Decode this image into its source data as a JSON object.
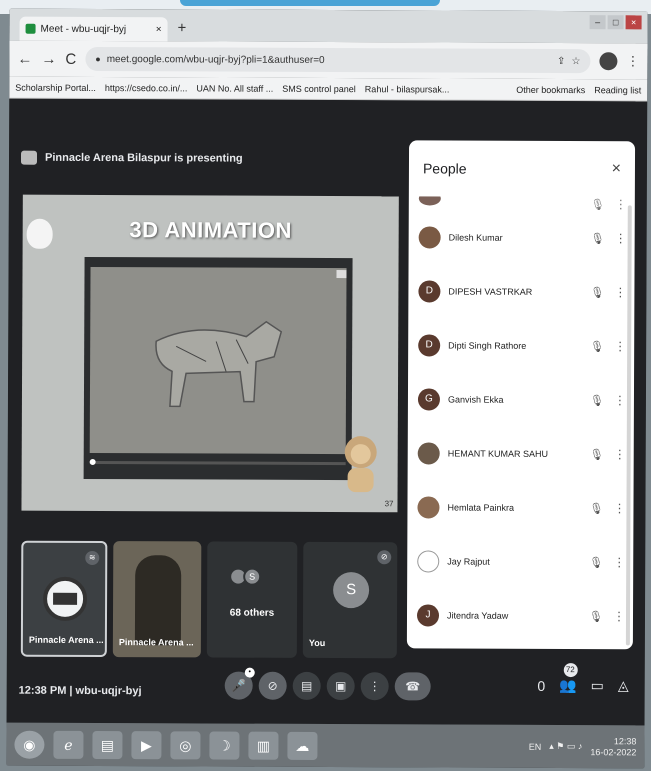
{
  "browser": {
    "tab_title": "Meet - wbu-uqjr-byj",
    "tab_close": "×",
    "new_tab": "+",
    "window_controls": [
      "–",
      "□",
      "×"
    ],
    "url": "meet.google.com/wbu-uqjr-byj?pli=1&authuser=0",
    "bookmarks": [
      "Scholarship Portal...",
      "https://csedo.co.in/...",
      "UAN No. All staff ...",
      "SMS control panel",
      "Rahul - bilaspursak...",
      "Other bookmarks",
      "Reading list"
    ]
  },
  "meet": {
    "presenting_text": "Pinnacle Arena Bilaspur is presenting",
    "slide_title": "3D ANIMATION",
    "slide_page": "37",
    "tiles": {
      "tile1_label": "Pinnacle Arena ...",
      "tile2_label": "Pinnacle Arena ...",
      "others_initial": "S",
      "others_label": "68 others",
      "you_initial": "S",
      "you_label": "You"
    },
    "meeting_info": "12:38 PM  |  wbu-uqjr-byj",
    "raise_hand_count": "0",
    "people_count": "72"
  },
  "people": {
    "title": "People",
    "close": "×",
    "participants": [
      {
        "initial": "",
        "name": ""
      },
      {
        "initial": "",
        "name": "Dilesh Kumar"
      },
      {
        "initial": "D",
        "name": "DIPESH VASTRKAR"
      },
      {
        "initial": "D",
        "name": "Dipti Singh Rathore"
      },
      {
        "initial": "G",
        "name": "Ganvish Ekka"
      },
      {
        "initial": "",
        "name": "HEMANT KUMAR SAHU"
      },
      {
        "initial": "",
        "name": "Hemlata Painkra"
      },
      {
        "initial": "",
        "name": "Jay Rajput"
      },
      {
        "initial": "J",
        "name": "Jitendra Yadaw"
      }
    ]
  },
  "taskbar": {
    "language": "EN",
    "time": "12:38",
    "date": "16-02-2022"
  }
}
